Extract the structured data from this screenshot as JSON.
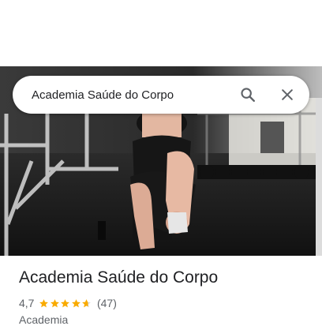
{
  "search": {
    "query": "Academia Saúde do Corpo"
  },
  "place": {
    "name": "Academia Saúde do Corpo",
    "rating": "4,7",
    "rating_value": 4.7,
    "rating_max": 5,
    "review_count": "(47)",
    "category": "Academia"
  },
  "icons": {
    "search": "search-icon",
    "close": "close-icon",
    "star": "star-icon"
  },
  "colors": {
    "star": "#f9ab00",
    "title_text": "#202124",
    "secondary_text": "#5f6368"
  }
}
